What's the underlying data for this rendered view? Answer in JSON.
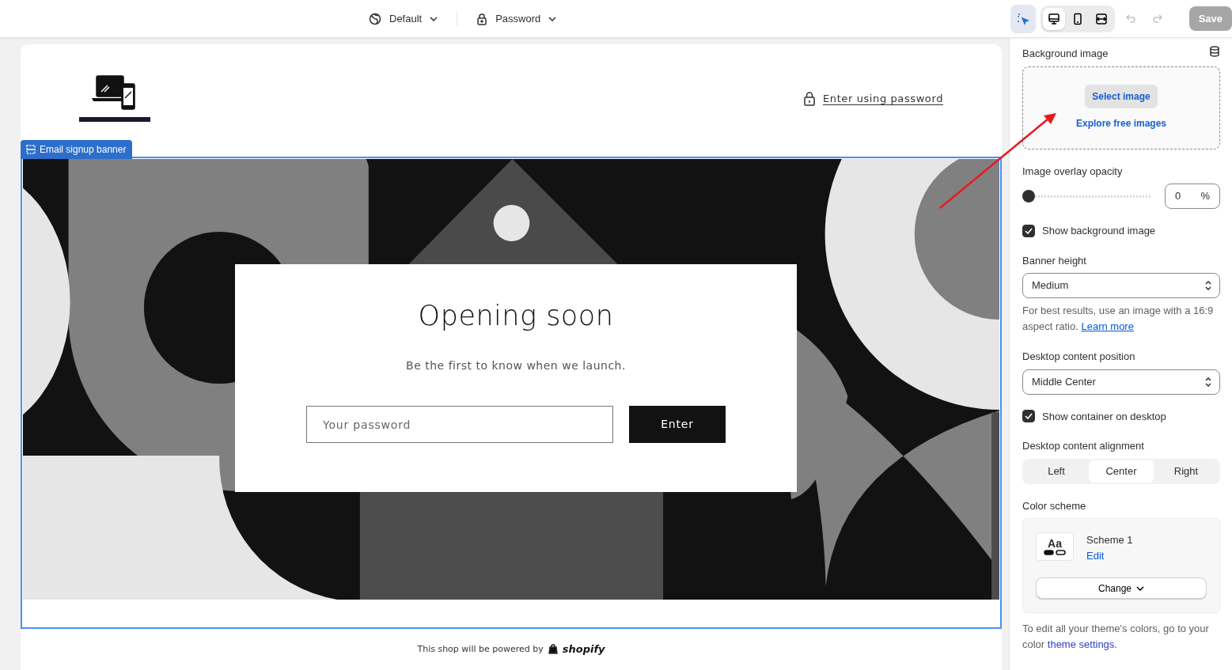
{
  "topbar": {
    "theme": "Default",
    "page": "Password",
    "inspector": {
      "selected": true
    },
    "views": [
      {
        "kind": "desktop",
        "selected": true
      },
      {
        "kind": "mobile",
        "selected": false
      },
      {
        "kind": "fullwidth",
        "selected": false
      }
    ],
    "undo": {
      "disabled": true
    },
    "redo": {
      "disabled": true
    },
    "save": {
      "label": "Save",
      "disabled": true
    }
  },
  "preview": {
    "header_link": "Enter using password",
    "section_tag": "Email signup banner",
    "banner": {
      "heading": "Opening soon",
      "text": "Be the first to know when we launch.",
      "placeholder": "Your password",
      "button": "Enter"
    },
    "footer": {
      "text": "This shop will be powered by",
      "brand": "shopify"
    }
  },
  "settings": [
    {
      "kind": "image",
      "label": "Background image",
      "button": "Select image",
      "link": "Explore free images"
    },
    {
      "kind": "slider",
      "label": "Image overlay opacity",
      "level": 0,
      "value": "0",
      "unit": "%"
    },
    {
      "kind": "checkbox",
      "label": "Show background image",
      "checked": true
    },
    {
      "kind": "select",
      "label": "Banner height",
      "value": "Medium",
      "help": "For best results, use an image with a 16:9 aspect ratio.",
      "help_link": "Learn more"
    },
    {
      "kind": "select",
      "label": "Desktop content position",
      "value": "Middle Center"
    },
    {
      "kind": "checkbox",
      "label": "Show container on desktop",
      "checked": true
    },
    {
      "kind": "segmented",
      "label": "Desktop content alignment",
      "options": [
        {
          "label": "Left",
          "selected": false
        },
        {
          "label": "Center",
          "selected": true
        },
        {
          "label": "Right",
          "selected": false
        }
      ]
    },
    {
      "kind": "scheme",
      "label": "Color scheme",
      "name": "Scheme 1",
      "sample": "Aa",
      "edit": "Edit",
      "button": "Change",
      "note": "To edit all your theme's colors, go to your color",
      "note_link": "theme settings",
      "note_end": "."
    }
  ]
}
